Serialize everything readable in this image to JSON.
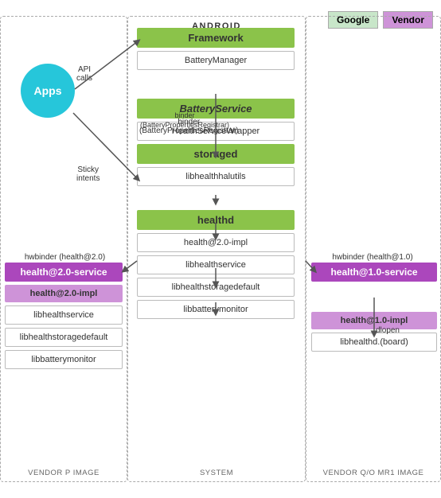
{
  "legend": {
    "google_label": "Google",
    "vendor_label": "Vendor"
  },
  "columns": {
    "vendor_p": {
      "title": "VENDOR P IMAGE"
    },
    "system": {
      "title": "ANDROID",
      "subtitle": "SYSTEM"
    },
    "vendor_qo": {
      "title": "VENDOR Q/O MR1 IMAGE"
    }
  },
  "apps": {
    "label": "Apps"
  },
  "arrow_labels": {
    "api_calls": "API\ncalls",
    "sticky_intents": "Sticky\nintents",
    "binder": "binder\n(BatteryPropertiesRegistrar)",
    "hwbinder_left": "hwbinder (health@2.0)",
    "hwbinder_right": "hwbinder (health@1.0)",
    "dlopen": "dlopen"
  },
  "android_blocks": {
    "framework_label": "Framework",
    "battery_manager": "BatteryManager",
    "battery_service": "BatteryService",
    "health_service_wrapper": "HealthServiceWrapper",
    "storaged_label": "storaged",
    "libhealthhalutils": "libhealthhalutils",
    "healthd_label": "healthd",
    "health_impl_mid": "health@2.0-impl",
    "libhealthservice_mid": "libhealthservice",
    "libhealthstoragedefault_mid": "libhealthstoragedefault",
    "libbatterymonitor_mid": "libbatterymonitor"
  },
  "vendor_p_blocks": {
    "service_label": "health@2.0-service",
    "impl_label": "health@2.0-impl",
    "libhealthservice": "libhealthservice",
    "libhealthstoragedefault": "libhealthstoragedefault",
    "libbatterymonitor": "libbatterymonitor"
  },
  "vendor_qo_blocks": {
    "service_label": "health@1.0-service",
    "impl_label": "health@1.0-impl",
    "libhealthd_board": "libhealthd.(board)"
  }
}
